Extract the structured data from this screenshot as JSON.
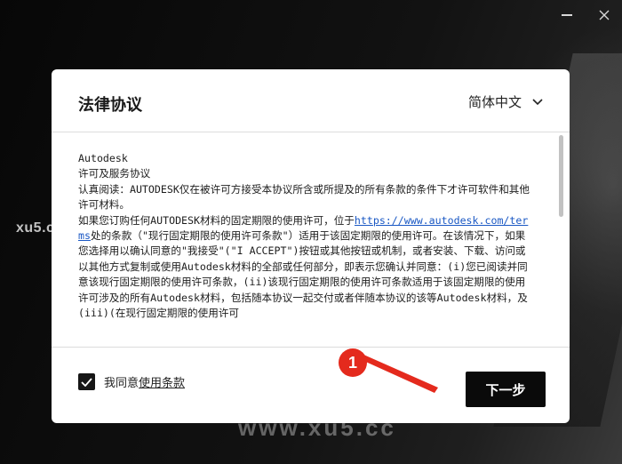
{
  "window": {
    "controls": [
      "minimize",
      "close"
    ]
  },
  "watermarks": {
    "left": "xu5.cc",
    "bottom": "www.xu5.cc"
  },
  "dialog": {
    "title": "法律协议",
    "language": {
      "selected": "简体中文",
      "icon": "chevron-down-icon"
    },
    "license": {
      "line1": "Autodesk",
      "line2": "许可及服务协议",
      "para1": "认真阅读：AUTODESK仅在被许可方接受本协议所含或所提及的所有条款的条件下才许可软件和其他许可材料。",
      "para2_before_link": "如果您订购任何AUTODESK材料的固定期限的使用许可，位于",
      "link": "https://www.autodesk.com/terms",
      "para2_after_link": "处的条款（\"现行固定期限的使用许可条款\"）适用于该固定期限的使用许可。在该情况下，如果您选择用以确认同意的\"我接受\"(\"I ACCEPT\")按钮或其他按钮或机制，或者安装、下载、访问或以其他方式复制或使用Autodesk材料的全部或任何部分，即表示您确认并同意：(i)您已阅读并同意该现行固定期限的使用许可条款，(ii)该现行固定期限的使用许可条款适用于该固定期限的使用许可涉及的所有Autodesk材料，包括随本协议一起交付或者伴随本协议的该等Autodesk材料，及(iii)(在现行固定期限的使用许可"
    },
    "agree": {
      "checked": true,
      "label_prefix": "我同意",
      "label_link": "使用条款"
    },
    "next_button": "下一步"
  },
  "annotation": {
    "badge": "1",
    "color": "#e42a1d"
  }
}
